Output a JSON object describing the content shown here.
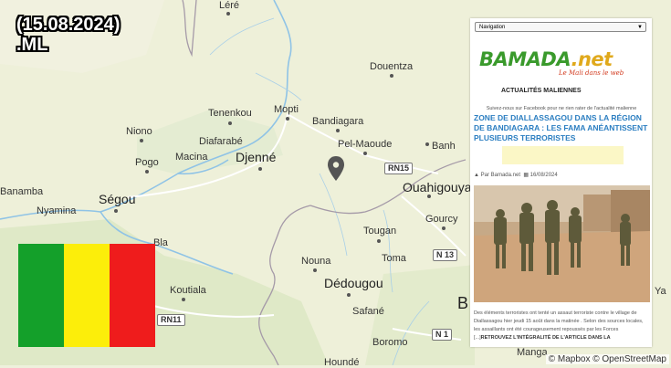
{
  "map": {
    "cities": [
      {
        "name": "Léré"
      },
      {
        "name": "Douentza"
      },
      {
        "name": "Tenenkou"
      },
      {
        "name": "Mopti"
      },
      {
        "name": "Bandiagara"
      },
      {
        "name": "Niono"
      },
      {
        "name": "Diafarabé"
      },
      {
        "name": "Pel-Maoude"
      },
      {
        "name": "Banh"
      },
      {
        "name": "Pogo"
      },
      {
        "name": "Macina"
      },
      {
        "name": "Djenné"
      },
      {
        "name": "Ouahigouya"
      },
      {
        "name": "Banamba"
      },
      {
        "name": "Ségou"
      },
      {
        "name": "Nyamina"
      },
      {
        "name": "Gourcy"
      },
      {
        "name": "Tougan"
      },
      {
        "name": "Bla"
      },
      {
        "name": "Nouna"
      },
      {
        "name": "Toma"
      },
      {
        "name": "Dédougou"
      },
      {
        "name": "Koutiala"
      },
      {
        "name": "Safané"
      },
      {
        "name": "Boromo"
      },
      {
        "name": "Manga"
      },
      {
        "name": "Houndé"
      },
      {
        "name": "B"
      },
      {
        "name": "Ya"
      }
    ],
    "roads": [
      "RN15",
      "N 13",
      "RN11",
      "N 1"
    ],
    "marker_icon": "map-pin-icon",
    "attribution": "© Mapbox © OpenStreetMap"
  },
  "overlay": {
    "date": "(15.08.2024)",
    "domain": ".ML",
    "flag_colors": [
      "#14a02a",
      "#fcee0a",
      "#ef1c1c"
    ]
  },
  "article": {
    "nav_label": "Navigation",
    "logo_main": "BAMADA",
    "logo_ext": ".net",
    "tagline": "Le Mali dans le web",
    "section": "ACTUALITÉS MALIENNES",
    "follow_text": "Suivez-nous sur Facebook pour ne rien rater de l'actualité malienne",
    "headline": "ZONE DE DIALLASSAGOU DANS LA RÉGION DE BANDIAGARA : LES FAMA ANÉANTISSENT PLUSIEURS TERRORISTES",
    "author": "Par Bamada.net",
    "date": "16/08/2024",
    "body": "Des éléments terroristes ont tenté un assaut terroriste contre le village de Diallassagou hier jeudi 15 août dans la matinée . Selon des sources locales, les assaillants ont été courageusement repoussés par les Forces [...]",
    "read_more": "RETROUVEZ L'INTÉGRALITÉ DE L'ARTICLE DANS LA"
  }
}
